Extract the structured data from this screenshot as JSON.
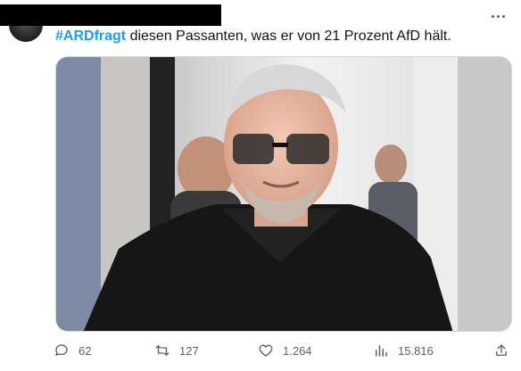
{
  "tweet": {
    "hashtag": "#ARDfragt",
    "text": " diesen Passanten, was er von 21 Prozent AfD hält."
  },
  "actions": {
    "replies": "62",
    "retweets": "127",
    "likes": "1.264",
    "views": "15.816"
  },
  "icons": {
    "more": "more-horizontal-icon",
    "reply": "reply-icon",
    "retweet": "retweet-icon",
    "like": "heart-icon",
    "views": "analytics-icon",
    "share": "share-icon"
  },
  "colors": {
    "hashtag": "#1d9bf0",
    "muted": "#536471"
  }
}
